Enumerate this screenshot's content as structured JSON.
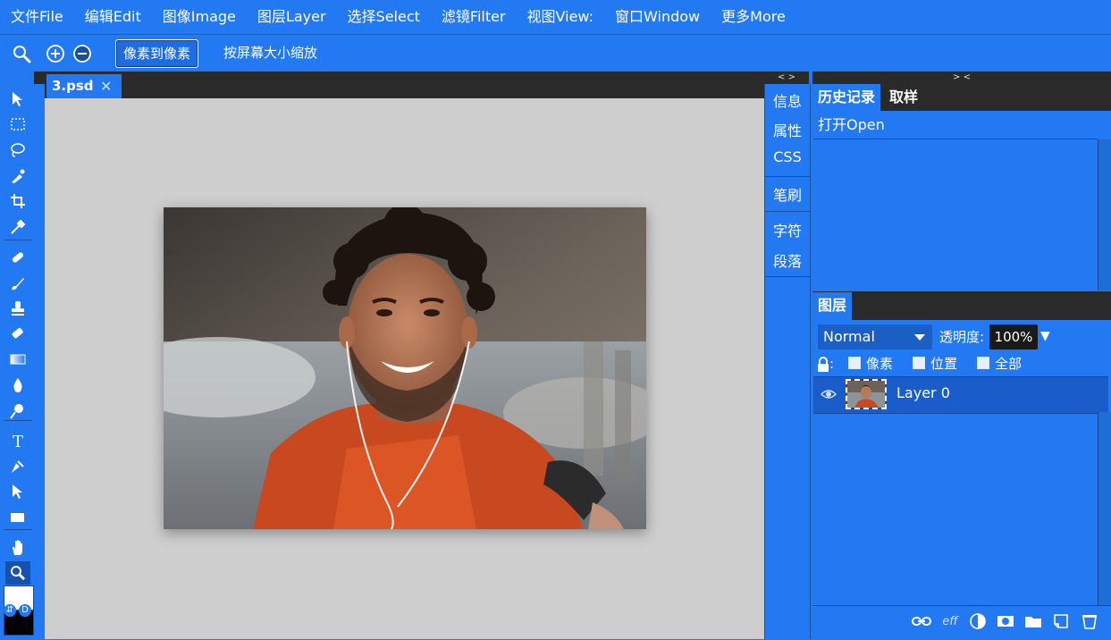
{
  "menu": [
    "文件File",
    "编辑Edit",
    "图像Image",
    "图层Layer",
    "选择Select",
    "滤镜Filter",
    "视图View:",
    "窗口Window",
    "更多More"
  ],
  "options": {
    "pixel_to_pixel": "像素到像素",
    "fit_screen": "按屏幕大小缩放"
  },
  "panel_toggles": {
    "left": "> <",
    "middle": "< >",
    "right": "> <"
  },
  "document": {
    "tab_name": "3.psd",
    "close_glyph": "✕"
  },
  "middle_panel": {
    "info": "信息",
    "properties": "属性",
    "css": "CSS",
    "brush": "笔刷",
    "character": "字符",
    "paragraph": "段落"
  },
  "history_panel": {
    "tabs": [
      "历史记录",
      "取样"
    ],
    "items": [
      "打开Open"
    ]
  },
  "layers_panel": {
    "tab": "图层",
    "blend_mode": "Normal",
    "opacity_label": "透明度:",
    "opacity_value": "100%",
    "lock_label": ":",
    "lock_options": [
      "像素",
      "位置",
      "全部"
    ],
    "layers": [
      {
        "name": "Layer 0",
        "visible": true
      }
    ],
    "footer_fx": "eff"
  },
  "colors": {
    "primary_blue": "#2379f2",
    "dark": "#2a2a2a",
    "canvas_bg": "#cecece",
    "foreground": "#ffffff",
    "background": "#000000"
  },
  "tools": [
    "move-icon",
    "marquee-icon",
    "lasso-icon",
    "quick-select-icon",
    "crop-icon",
    "eyedropper-icon",
    "healing-icon",
    "brush-icon",
    "stamp-icon",
    "eraser-icon",
    "gradient-icon",
    "blur-icon",
    "dodge-icon",
    "text-icon",
    "pen-icon",
    "path-select-icon",
    "shape-icon",
    "hand-icon",
    "zoom-icon"
  ]
}
